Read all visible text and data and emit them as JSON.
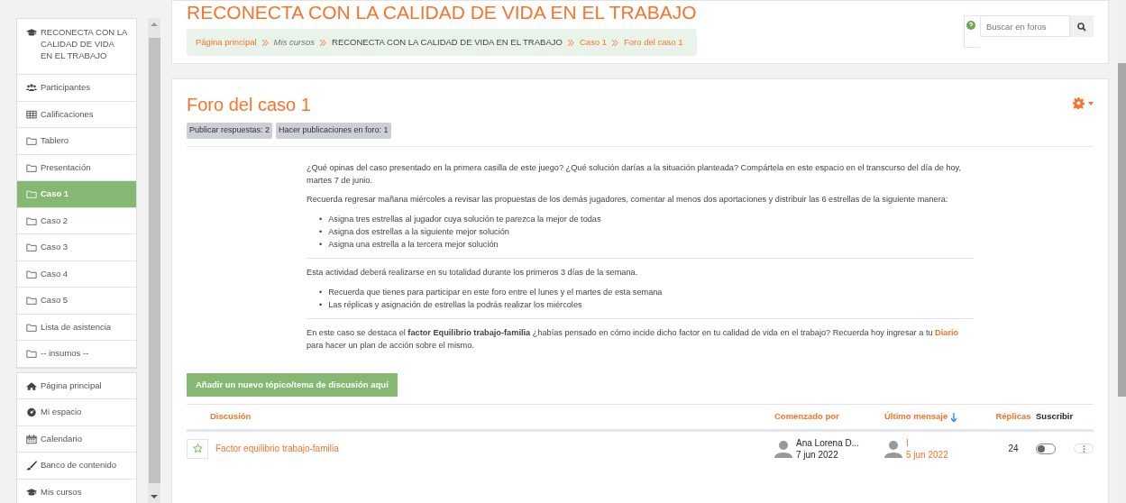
{
  "sidebar": {
    "groups": [
      {
        "items": [
          {
            "label": "RECONECTA CON LA CALIDAD DE VIDA EN EL TRABAJO",
            "kind": "course",
            "selected": false
          },
          {
            "label": "Participantes",
            "kind": "users",
            "selected": false
          },
          {
            "label": "Calificaciones",
            "kind": "table",
            "selected": false
          },
          {
            "label": "Tablero",
            "kind": "folder",
            "selected": false
          },
          {
            "label": "Presentación",
            "kind": "folder",
            "selected": false
          },
          {
            "label": "Caso 1",
            "kind": "folder",
            "selected": true
          },
          {
            "label": "Caso 2",
            "kind": "folder",
            "selected": false
          },
          {
            "label": "Caso 3",
            "kind": "folder",
            "selected": false
          },
          {
            "label": "Caso 4",
            "kind": "folder",
            "selected": false
          },
          {
            "label": "Caso 5",
            "kind": "folder",
            "selected": false
          },
          {
            "label": "Lista de asistencia",
            "kind": "folder",
            "selected": false
          },
          {
            "label": "-- insumos --",
            "kind": "folder",
            "selected": false
          }
        ]
      },
      {
        "items": [
          {
            "label": "Página principal",
            "kind": "home",
            "selected": false
          },
          {
            "label": "Mi espacio",
            "kind": "dashboard",
            "selected": false
          },
          {
            "label": "Calendario",
            "kind": "calendar",
            "selected": false
          },
          {
            "label": "Banco de contenido",
            "kind": "brush",
            "selected": false
          },
          {
            "label": "Mis cursos",
            "kind": "course",
            "selected": false
          }
        ]
      }
    ]
  },
  "header": {
    "title": "RECONECTA CON LA CALIDAD DE VIDA EN EL TRABAJO",
    "breadcrumb": [
      {
        "label": "Página principal",
        "kind": "link"
      },
      {
        "label": "Mis cursos",
        "kind": "muted"
      },
      {
        "label": "RECONECTA CON LA CALIDAD DE VIDA EN EL TRABAJO",
        "kind": "plain"
      },
      {
        "label": "Caso 1",
        "kind": "link"
      },
      {
        "label": "Foro del caso 1",
        "kind": "link"
      }
    ],
    "search": {
      "placeholder": "Buscar en foros"
    }
  },
  "forum": {
    "title": "Foro del caso 1",
    "badges": [
      "Publicar respuestas: 2",
      "Hacer publicaciones en foro: 1"
    ],
    "intro": [
      {
        "kind": "paragraph",
        "parts": [
          {
            "kind": "text",
            "text": "¿Qué opinas del caso presentado en la primera casilla de este juego? ¿Qué solución darías a la situación planteada? Compártela en este espacio en el transcurso del día de hoy, martes 7 de junio."
          }
        ]
      },
      {
        "kind": "paragraph",
        "parts": [
          {
            "kind": "text",
            "text": "Recuerda regresar mañana miércoles a revisar las propuestas de los demás jugadores, comentar al menos dos aportaciones y distribuir las 6 estrellas de la siguiente manera:"
          }
        ]
      },
      {
        "kind": "list",
        "marker": "•",
        "items": [
          "Asigna tres estrellas al jugador cuya solución te parezca la mejor de todas",
          "Asigna dos estrellas a la siguiente mejor solución",
          "Asigna una estrella a la tercera mejor solución"
        ]
      },
      {
        "kind": "rule"
      },
      {
        "kind": "paragraph",
        "parts": [
          {
            "kind": "text",
            "text": "Esta actividad deberá realizarse en su totalidad durante los primeros 3 días de la semana."
          }
        ]
      },
      {
        "kind": "list",
        "marker": "•",
        "items": [
          "Recuerda que tienes para participar en este foro entre el lunes y el martes de esta semana",
          "Las réplicas y asignación de estrellas la podrás realizar los miércoles"
        ]
      },
      {
        "kind": "rule"
      },
      {
        "kind": "paragraph",
        "parts": [
          {
            "kind": "text",
            "text": "En este caso se destaca el **factor Equilibrio trabajo-familia** ¿habías pensado en cómo incide dicho factor en tu calidad de vida en el trabajo? Recuerda hoy ingresar a tu "
          },
          {
            "kind": "link",
            "text": "Diario"
          },
          {
            "kind": "text",
            "text": " para hacer un plan de acción sobre el mismo."
          }
        ]
      }
    ],
    "add_button": "Añadir un nuevo tópico/tema de discusión aquí",
    "table": {
      "columns": [
        {
          "label": "Discusión",
          "link": true,
          "sorted": false
        },
        {
          "label": "Comenzado por",
          "link": true,
          "sorted": false
        },
        {
          "label": "Último mensaje",
          "link": true,
          "sorted": true
        },
        {
          "label": "Réplicas",
          "link": true,
          "sorted": false
        },
        {
          "label": "Suscribir",
          "link": false,
          "sorted": false
        }
      ],
      "rows": [
        {
          "starred": false,
          "title": "Factor equilibrio trabajo-familia",
          "started_by": {
            "name": "Ana Lorena D...",
            "date": "7 jun 2022"
          },
          "last_post": {
            "name": "I",
            "date": "5 jun 2022"
          },
          "replies": "24",
          "subscribed": false
        }
      ]
    }
  }
}
